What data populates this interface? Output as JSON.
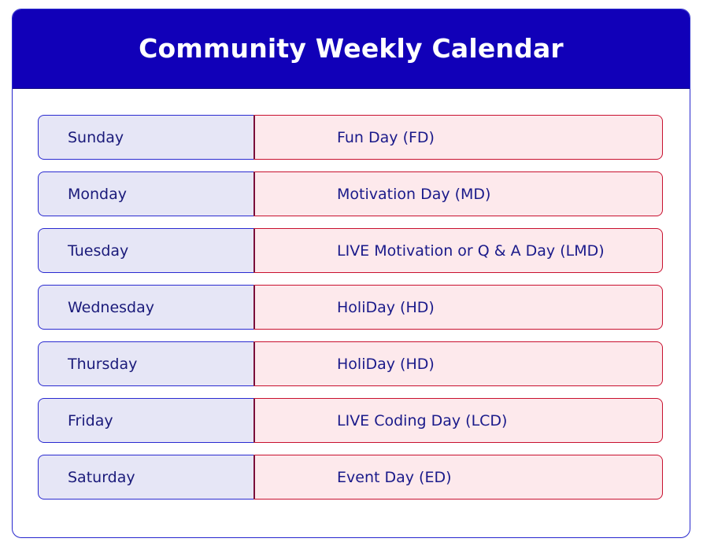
{
  "header": {
    "title": "Community Weekly Calendar"
  },
  "schedule": [
    {
      "day": "Sunday",
      "event": "Fun Day (FD)"
    },
    {
      "day": "Monday",
      "event": "Motivation Day (MD)"
    },
    {
      "day": "Tuesday",
      "event": "LIVE Motivation or Q & A Day (LMD)"
    },
    {
      "day": "Wednesday",
      "event": "HoliDay (HD)"
    },
    {
      "day": "Thursday",
      "event": "HoliDay (HD)"
    },
    {
      "day": "Friday",
      "event": "LIVE Coding Day (LCD)"
    },
    {
      "day": "Saturday",
      "event": "Event Day (ED)"
    }
  ],
  "colors": {
    "header_bg": "#1100b8",
    "day_bg": "#e6e6f6",
    "event_bg": "#fde9ec",
    "day_border": "#2a2ad0",
    "event_border": "#c8102e"
  }
}
